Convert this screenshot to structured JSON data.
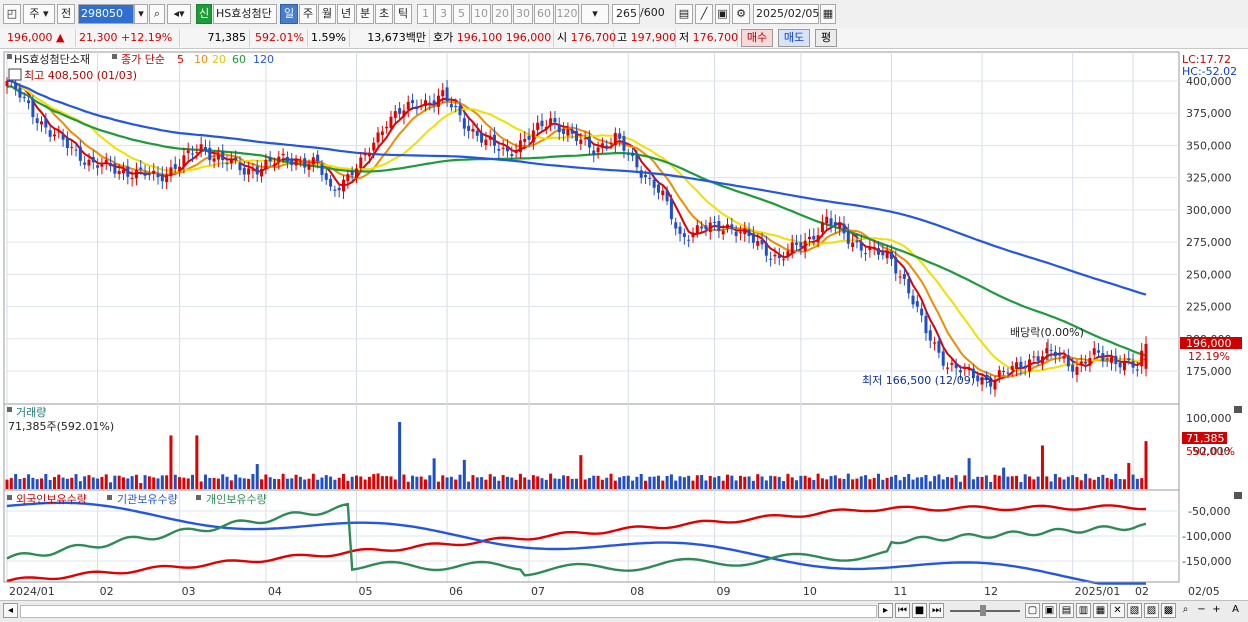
{
  "toolbar": {
    "period_main": "주",
    "prev_label": "전",
    "code": "298050",
    "stock_badge": "신",
    "stock_name": "HS효성첨단",
    "periods": [
      "일",
      "주",
      "월",
      "년",
      "분",
      "초",
      "틱"
    ],
    "active_period": "일",
    "numbers": [
      "1",
      "3",
      "5",
      "10",
      "20",
      "30",
      "60",
      "120"
    ],
    "count_display": "265",
    "count_total": "/600",
    "date": "2025/02/05"
  },
  "quote": {
    "price": "196,000",
    "change_arrow": "▲",
    "change": "21,300",
    "change_pct": "+12.19%",
    "volume": "71,385",
    "volume_ratio": "592.01%",
    "turnover": "1.59%",
    "amount": "13,673백만",
    "ask_label": "호가",
    "ask": "196,100",
    "bid": "196,000",
    "open_label": "시",
    "open": "176,700",
    "high_label": "고",
    "high": "197,900",
    "low_label": "저",
    "low": "176,700",
    "buy_button": "매수",
    "sell_button": "매도",
    "eval_button": "평"
  },
  "price_panel": {
    "name_label": "HS효성첨단소재",
    "ma_title": "종가 단순",
    "ma_periods": [
      "5",
      "10",
      "20",
      "60",
      "120"
    ],
    "ma_colors": [
      "#e00000",
      "#f08c00",
      "#f0e000",
      "#1f9a3a",
      "#2457e0"
    ],
    "high_note": "최고 408,500 (01/03)",
    "low_note": "최저 166,500 (12/09)",
    "dividend_note": "배당락(0.00%)",
    "lc": "LC:17.72",
    "hc": "HC:-52.02",
    "y_ticks": [
      "400,000",
      "375,000",
      "350,000",
      "325,000",
      "300,000",
      "275,000",
      "250,000",
      "225,000",
      "200,000",
      "175,000"
    ],
    "current_tag": "196,000",
    "current_pct_tag": "12.19%"
  },
  "volume_panel": {
    "title": "거래량",
    "value_label": "71,385주(592.01%)",
    "y_ticks": [
      "100,000",
      "50,000"
    ],
    "current_tag": "71,385",
    "current_pct_tag": "592.01%"
  },
  "holdings_panel": {
    "series": [
      {
        "name": "외국인보유수량",
        "color": "#e00000"
      },
      {
        "name": "기관보유수량",
        "color": "#2457e0"
      },
      {
        "name": "개인보유수량",
        "color": "#2e8b57"
      }
    ],
    "y_ticks": [
      "-50,000",
      "-100,000",
      "-150,000"
    ]
  },
  "x_axis": {
    "labels": [
      "2024/01",
      "02",
      "03",
      "04",
      "05",
      "06",
      "07",
      "08",
      "09",
      "10",
      "11",
      "12",
      "2025/01",
      "02"
    ],
    "right_label": "02/05"
  }
}
